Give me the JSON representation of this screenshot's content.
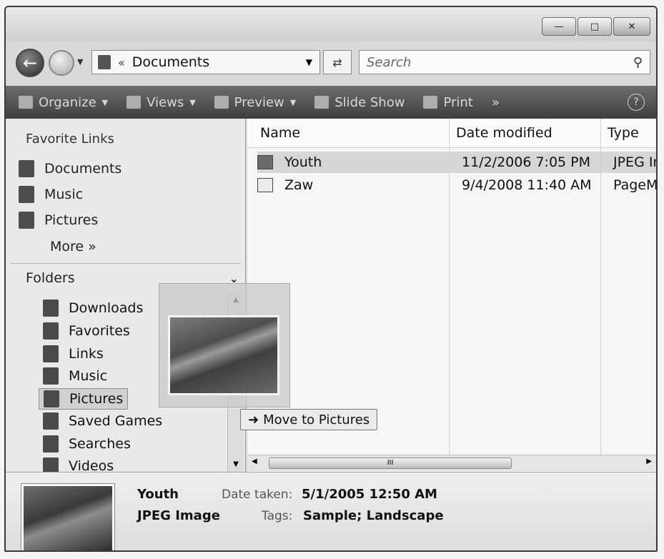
{
  "window": {
    "minimize_icon": "minimize-icon",
    "maximize_icon": "maximize-icon",
    "close_icon": "close-icon"
  },
  "address": {
    "chevron": "«",
    "path": "Documents"
  },
  "search": {
    "placeholder": "Search"
  },
  "toolbar": {
    "organize": "Organize",
    "views": "Views",
    "preview": "Preview",
    "slideshow": "Slide Show",
    "print": "Print",
    "more": "»",
    "help": "?"
  },
  "nav": {
    "favorite_links_title": "Favorite Links",
    "favorites": [
      "Documents",
      "Music",
      "Pictures"
    ],
    "more": "More »",
    "folders_title": "Folders",
    "folders": [
      "Downloads",
      "Favorites",
      "Links",
      "Music",
      "Pictures",
      "Saved Games",
      "Searches",
      "Videos"
    ],
    "selected_folder": "Pictures"
  },
  "columns": {
    "name": "Name",
    "date": "Date modified",
    "type": "Type"
  },
  "files": [
    {
      "name": "Youth",
      "date": "11/2/2006 7:05 PM",
      "type": "JPEG In"
    },
    {
      "name": "Zaw",
      "date": "9/4/2008 11:40 AM",
      "type": "PageM"
    }
  ],
  "drag": {
    "tooltip": "Move to Pictures"
  },
  "scrollbar": {
    "grip": "III"
  },
  "details": {
    "name": "Youth",
    "kind": "JPEG Image",
    "date_label": "Date taken:",
    "date_value": "5/1/2005 12:50 AM",
    "tags_label": "Tags:",
    "tags_value": "Sample; Landscape"
  }
}
